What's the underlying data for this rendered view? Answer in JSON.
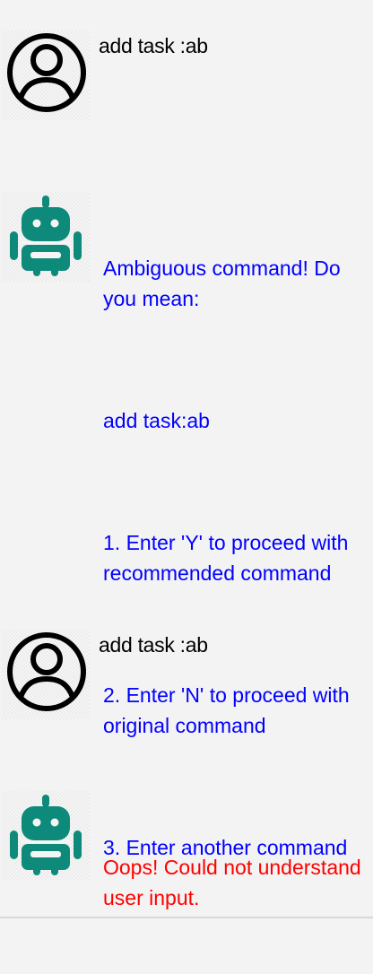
{
  "colors": {
    "background": "#f3f3f3",
    "user_text": "#000000",
    "bot_info": "#0000ff",
    "bot_error": "#ff0000",
    "bot_avatar": "#0e8a7a",
    "user_avatar": "#000000"
  },
  "icons": {
    "user": "user-icon",
    "bot": "robot-icon"
  },
  "messages": [
    {
      "sender": "user",
      "text": "add task :ab"
    },
    {
      "sender": "bot",
      "status": "info",
      "paragraphs": [
        "Ambiguous command! Do you mean:",
        "add task:ab",
        "1. Enter 'Y' to proceed with recommended command",
        "2. Enter 'N' to proceed with original command",
        "3. Enter another command"
      ]
    },
    {
      "sender": "user",
      "text": "add task :ab"
    },
    {
      "sender": "bot",
      "status": "error",
      "paragraphs": [
        "Oops! Could not understand user input."
      ]
    }
  ]
}
